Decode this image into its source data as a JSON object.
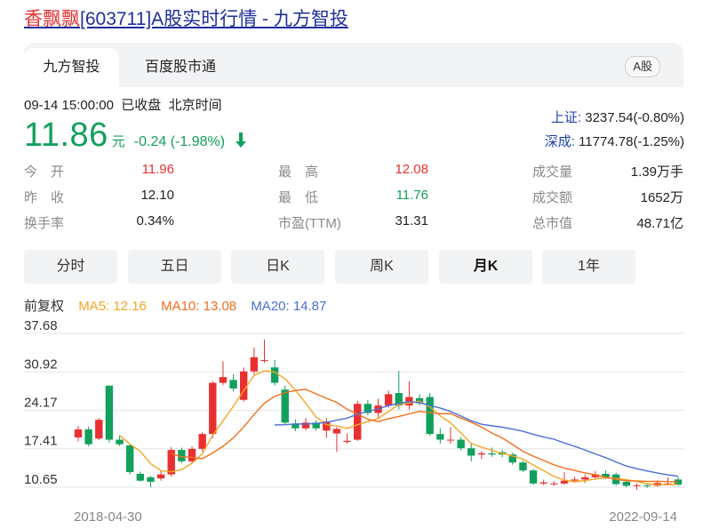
{
  "title": {
    "name": "香飘飘",
    "rest": "[603711]A股实时行情 - 九方智投"
  },
  "tabs": [
    {
      "label": "九方智投"
    },
    {
      "label": "百度股市通"
    }
  ],
  "market_badge": "A股",
  "status": {
    "time": "09-14 15:00:00",
    "state": "已收盘",
    "zone": "北京时间"
  },
  "quote": {
    "price": "11.86",
    "unit": "元",
    "change": "-0.24",
    "change_pct": "(-1.98%)"
  },
  "indices": [
    {
      "name": "上证:",
      "value": "3237.54(-0.80%)"
    },
    {
      "name": "深成:",
      "value": "11774.78(-1.25%)"
    }
  ],
  "stats": {
    "open": {
      "label": "今　开",
      "value": "11.96"
    },
    "prev_close": {
      "label": "昨　收",
      "value": "12.10"
    },
    "turnover": {
      "label": "换手率",
      "value": "0.34%"
    },
    "high": {
      "label": "最　高",
      "value": "12.08"
    },
    "low": {
      "label": "最　低",
      "value": "11.76"
    },
    "pe": {
      "label": "市盈(TTM)",
      "value": "31.31"
    },
    "volume": {
      "label": "成交量",
      "value": "1.39万手"
    },
    "amount": {
      "label": "成交额",
      "value": "1652万"
    },
    "mktcap": {
      "label": "总市值",
      "value": "48.71亿"
    }
  },
  "ranges": [
    {
      "label": "分时"
    },
    {
      "label": "五日"
    },
    {
      "label": "日K"
    },
    {
      "label": "周K"
    },
    {
      "label": "月K"
    },
    {
      "label": "1年"
    }
  ],
  "active_range": "月K",
  "adjust_label": "前复权",
  "ma_legend": [
    {
      "label": "MA5: 12.16",
      "color": "#f5a623"
    },
    {
      "label": "MA10: 13.08",
      "color": "#f06f1e"
    },
    {
      "label": "MA20: 14.87",
      "color": "#4a6fd8"
    }
  ],
  "colors": {
    "up": "#e83030",
    "down": "#12a05c",
    "ma5": "#f5a623",
    "ma10": "#f06f1e",
    "ma20": "#4a6fd8",
    "accent_blue": "#1f2f9a"
  },
  "chart_data": {
    "type": "candlestick",
    "period": "monthly",
    "x_start_label": "2018-04-30",
    "x_end_label": "2022-09-14",
    "y_ticks": [
      37.68,
      30.92,
      24.17,
      17.41,
      10.65
    ],
    "ylim": [
      10.65,
      37.68
    ],
    "grid": true,
    "candles": [
      {
        "o": 19.4,
        "c": 20.8,
        "h": 21.4,
        "l": 18.7
      },
      {
        "o": 20.8,
        "c": 18.2,
        "h": 21.3,
        "l": 17.8
      },
      {
        "o": 19.2,
        "c": 22.5,
        "h": 22.8,
        "l": 18.9
      },
      {
        "o": 28.5,
        "c": 19.0,
        "h": 28.5,
        "l": 18.5
      },
      {
        "o": 19.0,
        "c": 18.2,
        "h": 19.8,
        "l": 17.9
      },
      {
        "o": 18.0,
        "c": 13.3,
        "h": 18.2,
        "l": 12.9
      },
      {
        "o": 13.0,
        "c": 11.8,
        "h": 13.4,
        "l": 11.6
      },
      {
        "o": 12.4,
        "c": 11.6,
        "h": 12.6,
        "l": 10.6
      },
      {
        "o": 12.2,
        "c": 12.9,
        "h": 13.6,
        "l": 11.8
      },
      {
        "o": 12.9,
        "c": 17.2,
        "h": 17.7,
        "l": 12.5
      },
      {
        "o": 17.2,
        "c": 15.2,
        "h": 17.6,
        "l": 14.9
      },
      {
        "o": 15.2,
        "c": 17.4,
        "h": 17.8,
        "l": 14.8
      },
      {
        "o": 17.4,
        "c": 20.0,
        "h": 20.3,
        "l": 16.9
      },
      {
        "o": 20.0,
        "c": 29.0,
        "h": 29.3,
        "l": 19.3
      },
      {
        "o": 29.0,
        "c": 30.0,
        "h": 32.8,
        "l": 28.6
      },
      {
        "o": 29.5,
        "c": 28.0,
        "h": 30.5,
        "l": 27.5
      },
      {
        "o": 26.0,
        "c": 31.0,
        "h": 31.7,
        "l": 25.7
      },
      {
        "o": 31.0,
        "c": 33.5,
        "h": 35.2,
        "l": 30.5
      },
      {
        "o": 33.0,
        "c": 33.0,
        "h": 36.6,
        "l": 32.5
      },
      {
        "o": 31.7,
        "c": 29.0,
        "h": 33.0,
        "l": 28.5
      },
      {
        "o": 27.8,
        "c": 22.0,
        "h": 28.5,
        "l": 21.7
      },
      {
        "o": 21.8,
        "c": 21.0,
        "h": 22.6,
        "l": 20.5
      },
      {
        "o": 21.0,
        "c": 22.0,
        "h": 22.8,
        "l": 20.6
      },
      {
        "o": 22.0,
        "c": 21.0,
        "h": 22.4,
        "l": 20.6
      },
      {
        "o": 20.6,
        "c": 22.2,
        "h": 22.8,
        "l": 19.3
      },
      {
        "o": 20.1,
        "c": 20.9,
        "h": 21.2,
        "l": 16.9
      },
      {
        "o": 18.6,
        "c": 18.8,
        "h": 20.1,
        "l": 18.3
      },
      {
        "o": 19.0,
        "c": 25.3,
        "h": 25.8,
        "l": 18.8
      },
      {
        "o": 25.3,
        "c": 23.7,
        "h": 26.0,
        "l": 23.3
      },
      {
        "o": 23.7,
        "c": 25.0,
        "h": 26.2,
        "l": 22.7
      },
      {
        "o": 25.0,
        "c": 27.0,
        "h": 27.6,
        "l": 24.6
      },
      {
        "o": 27.2,
        "c": 25.0,
        "h": 31.1,
        "l": 24.3
      },
      {
        "o": 25.0,
        "c": 26.5,
        "h": 29.3,
        "l": 24.3
      },
      {
        "o": 26.3,
        "c": 25.4,
        "h": 27.0,
        "l": 25.0
      },
      {
        "o": 26.5,
        "c": 20.0,
        "h": 27.2,
        "l": 19.7
      },
      {
        "o": 20.0,
        "c": 19.0,
        "h": 21.0,
        "l": 18.3
      },
      {
        "o": 19.0,
        "c": 19.0,
        "h": 21.2,
        "l": 18.3
      },
      {
        "o": 19.0,
        "c": 17.5,
        "h": 19.5,
        "l": 17.1
      },
      {
        "o": 17.5,
        "c": 16.2,
        "h": 18.3,
        "l": 15.2
      },
      {
        "o": 16.4,
        "c": 16.6,
        "h": 17.0,
        "l": 15.6
      },
      {
        "o": 16.6,
        "c": 16.4,
        "h": 17.6,
        "l": 16.0
      },
      {
        "o": 16.8,
        "c": 16.4,
        "h": 17.2,
        "l": 15.9
      },
      {
        "o": 16.4,
        "c": 15.0,
        "h": 16.7,
        "l": 14.6
      },
      {
        "o": 15.0,
        "c": 13.6,
        "h": 15.3,
        "l": 13.3
      },
      {
        "o": 13.6,
        "c": 11.3,
        "h": 13.9,
        "l": 11.1
      },
      {
        "o": 11.3,
        "c": 11.5,
        "h": 12.0,
        "l": 11.0
      },
      {
        "o": 11.2,
        "c": 11.3,
        "h": 11.7,
        "l": 10.9
      },
      {
        "o": 11.3,
        "c": 11.8,
        "h": 13.3,
        "l": 11.1
      },
      {
        "o": 11.8,
        "c": 12.0,
        "h": 12.5,
        "l": 11.5
      },
      {
        "o": 12.0,
        "c": 12.4,
        "h": 12.9,
        "l": 11.4
      },
      {
        "o": 12.4,
        "c": 12.9,
        "h": 13.5,
        "l": 12.2
      },
      {
        "o": 13.0,
        "c": 12.4,
        "h": 13.6,
        "l": 12.1
      },
      {
        "o": 12.9,
        "c": 11.2,
        "h": 13.2,
        "l": 10.9
      },
      {
        "o": 11.6,
        "c": 10.9,
        "h": 11.9,
        "l": 10.6
      },
      {
        "o": 10.9,
        "c": 11.0,
        "h": 11.3,
        "l": 10.2
      },
      {
        "o": 11.0,
        "c": 10.9,
        "h": 11.3,
        "l": 10.5
      },
      {
        "o": 10.9,
        "c": 11.4,
        "h": 11.8,
        "l": 10.8
      },
      {
        "o": 11.2,
        "c": 11.3,
        "h": 12.4,
        "l": 11.0
      },
      {
        "o": 12.0,
        "c": 11.1,
        "h": 12.4,
        "l": 10.9
      }
    ]
  }
}
